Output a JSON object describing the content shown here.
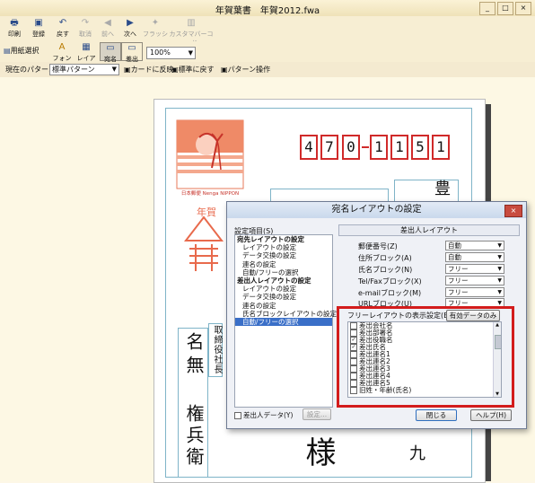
{
  "window": {
    "title": "年賀葉書　年賀2012.fwa",
    "controls": [
      "_",
      "□",
      "×"
    ]
  },
  "toolbar1": [
    {
      "label": "印刷",
      "icon": "printer-icon"
    },
    {
      "label": "登録",
      "icon": "save-icon"
    },
    {
      "label": "戻す",
      "icon": "undo-icon"
    },
    {
      "label": "取消",
      "icon": "redo-icon"
    },
    {
      "label": "前へ",
      "icon": "prev-icon"
    },
    {
      "label": "次へ",
      "icon": "next-icon"
    },
    {
      "label": "フラッシュ",
      "icon": "flash-icon"
    },
    {
      "label": "カスタマバーコード",
      "icon": "barcode-icon"
    }
  ],
  "toolbar2": {
    "paper_select": "用紙選択",
    "font": "フォント",
    "layout": "レイアウト",
    "btn_a": "宛名",
    "btn_b": "差出",
    "zoom": "100%"
  },
  "toolbar3": {
    "current_pattern_label": "現在のパターン",
    "pattern_value": "標準パターン",
    "apply_to_card": "カードに反映",
    "restore_default": "標準に戻す",
    "pattern_ops": "パターン操作"
  },
  "card": {
    "zip_digits": [
      "4",
      "7",
      "0",
      "1",
      "1",
      "5",
      "1"
    ],
    "stamp_caption": "日本郵便 Nenga NIPPON",
    "name_title": "取締役社長",
    "name_part1": "名無",
    "name_part2": "権兵衛",
    "honorific": "様",
    "addr_top": "豊",
    "addr_bottom": "九"
  },
  "dialog": {
    "title": "宛名レイアウトの設定",
    "close": "×",
    "settings_label": "設定項目(S)",
    "tree": [
      {
        "label": "宛先レイアウトの設定",
        "level": 0
      },
      {
        "label": "レイアウトの設定",
        "level": 1
      },
      {
        "label": "データ交換の設定",
        "level": 1
      },
      {
        "label": "連名の設定",
        "level": 1
      },
      {
        "label": "自動/フリーの選択",
        "level": 1
      },
      {
        "label": "差出人レイアウトの設定",
        "level": 0
      },
      {
        "label": "レイアウトの設定",
        "level": 1
      },
      {
        "label": "データ交換の設定",
        "level": 1
      },
      {
        "label": "連名の設定",
        "level": 1
      },
      {
        "label": "氏名ブロックレイアウトの設定",
        "level": 1
      },
      {
        "label": "自動/フリーの選択",
        "level": 1,
        "selected": true
      }
    ],
    "panel_header": "差出人レイアウト",
    "rows": [
      {
        "label": "郵便番号(Z)",
        "value": "自動"
      },
      {
        "label": "住所ブロック(A)",
        "value": "自動"
      },
      {
        "label": "氏名ブロック(N)",
        "value": "フリー"
      },
      {
        "label": "Tel/Faxブロック(X)",
        "value": "フリー"
      },
      {
        "label": "e-mailブロック(M)",
        "value": "フリー"
      },
      {
        "label": "URLブロック(U)",
        "value": "フリー"
      }
    ],
    "free_list_label": "フリーレイアウトの表示設定(E)",
    "only_data_button": "有効データのみ",
    "free_items": [
      {
        "label": "差出会社名",
        "checked": false
      },
      {
        "label": "差出部署名",
        "checked": false
      },
      {
        "label": "差出役職名",
        "checked": true
      },
      {
        "label": "差出氏名",
        "checked": true
      },
      {
        "label": "差出連名1",
        "checked": false
      },
      {
        "label": "差出連名2",
        "checked": false
      },
      {
        "label": "差出連名3",
        "checked": false
      },
      {
        "label": "差出連名4",
        "checked": false
      },
      {
        "label": "差出連名5",
        "checked": false
      },
      {
        "label": "旧姓・年齢(氏名)",
        "checked": false
      }
    ],
    "sender_data_checkbox": "差出人データ(Y)",
    "settings_button": "設定...",
    "close_button": "閉じる",
    "help_button": "ヘルプ(H)"
  }
}
